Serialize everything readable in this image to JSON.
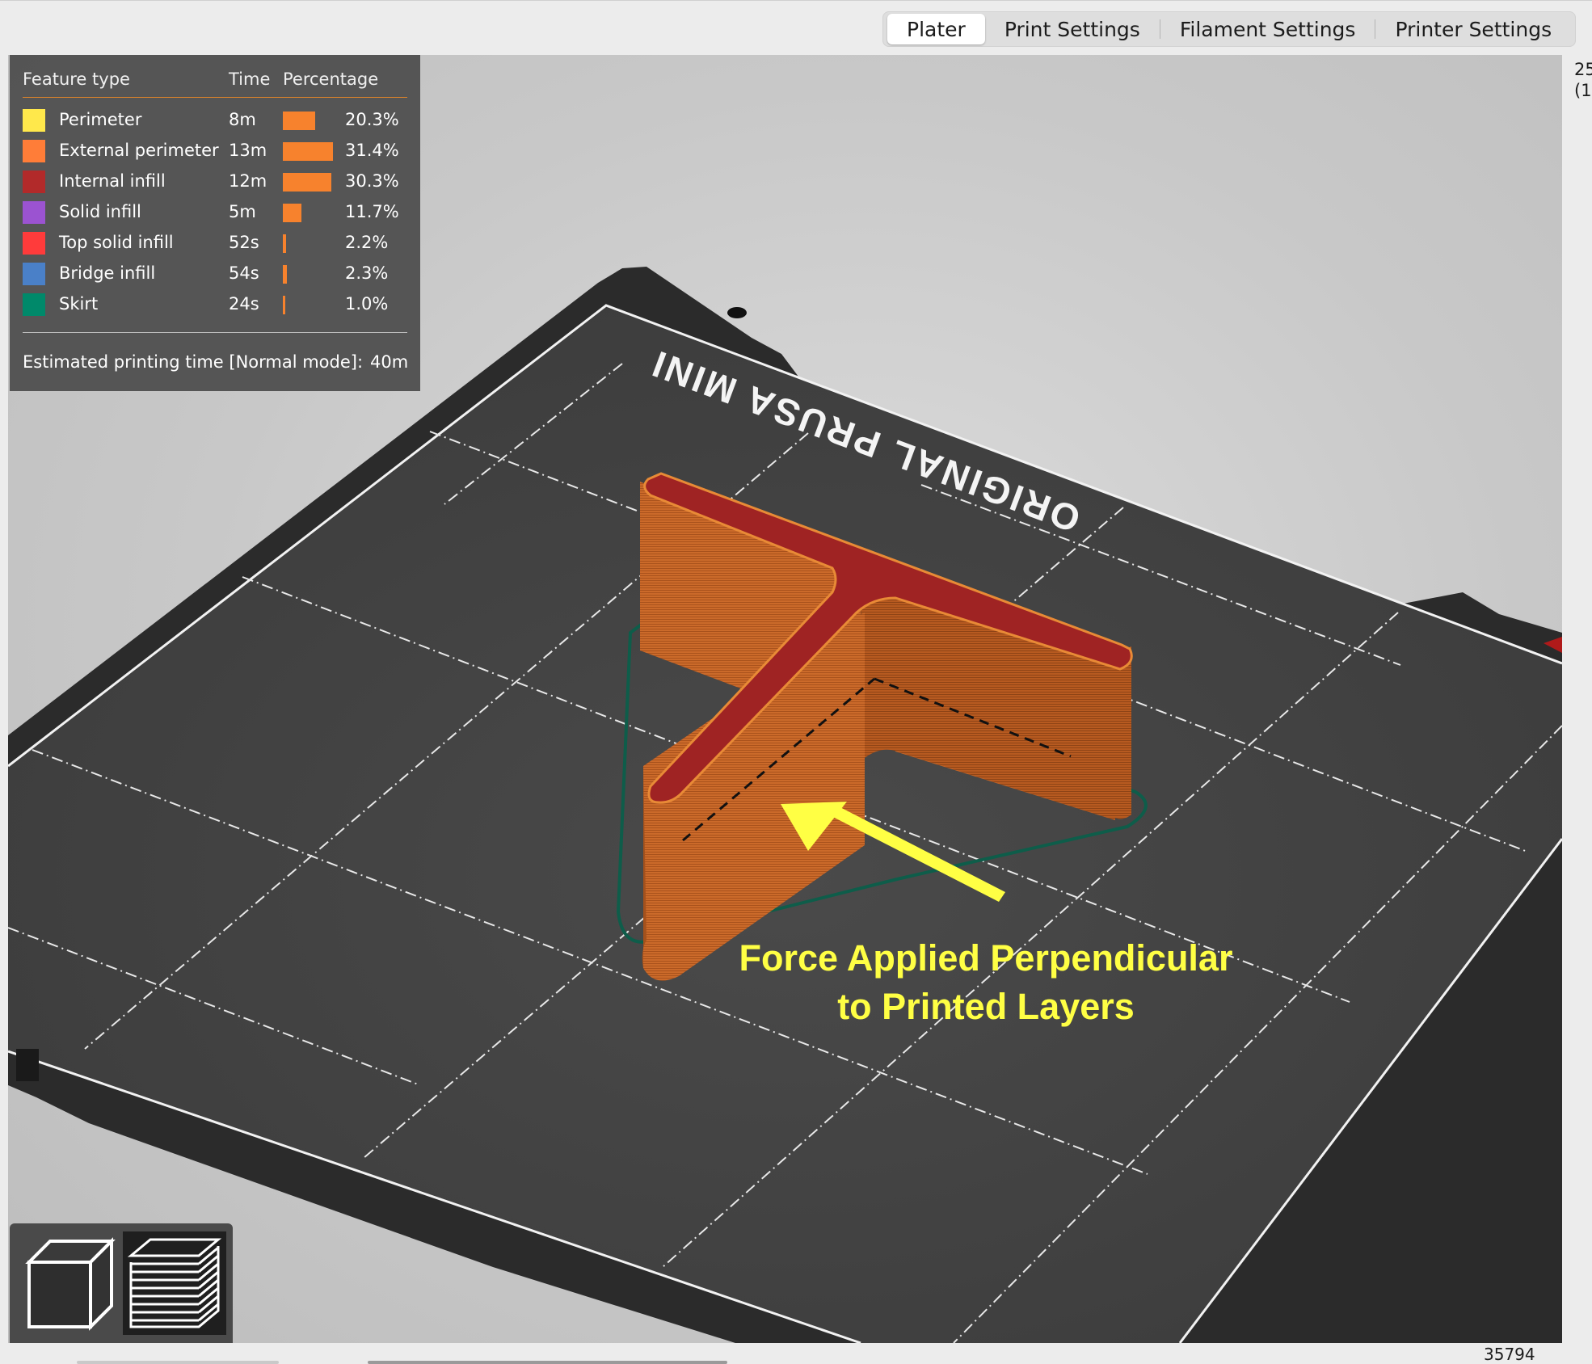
{
  "tabs": [
    {
      "label": "Plater",
      "active": true
    },
    {
      "label": "Print Settings",
      "active": false
    },
    {
      "label": "Filament Settings",
      "active": false
    },
    {
      "label": "Printer Settings",
      "active": false
    }
  ],
  "legend": {
    "headers": {
      "feature": "Feature type",
      "time": "Time",
      "percentage": "Percentage"
    },
    "rows": [
      {
        "name": "Perimeter",
        "time": "8m",
        "percent": "20.3%",
        "fraction": 0.203,
        "color": "#ffe84b"
      },
      {
        "name": "External perimeter",
        "time": "13m",
        "percent": "31.4%",
        "fraction": 0.314,
        "color": "#ff7d38"
      },
      {
        "name": "Internal infill",
        "time": "12m",
        "percent": "30.3%",
        "fraction": 0.303,
        "color": "#b22a2a"
      },
      {
        "name": "Solid infill",
        "time": "5m",
        "percent": "11.7%",
        "fraction": 0.117,
        "color": "#9b53d1"
      },
      {
        "name": "Top solid infill",
        "time": "52s",
        "percent": "2.2%",
        "fraction": 0.022,
        "color": "#ff3b3b"
      },
      {
        "name": "Bridge infill",
        "time": "54s",
        "percent": "2.3%",
        "fraction": 0.023,
        "color": "#4a80c8"
      },
      {
        "name": "Skirt",
        "time": "24s",
        "percent": "1.0%",
        "fraction": 0.01,
        "color": "#00896a"
      }
    ],
    "estimate_label": "Estimated printing time [Normal mode]:",
    "estimate_value": "40m",
    "bar_color": "#f7822d"
  },
  "bed": {
    "label": "ORIGINAL PRUSA MINI"
  },
  "annotation": {
    "line1": "Force Applied Perpendicular",
    "line2": "to Printed Layers",
    "color": "#ffff44"
  },
  "view_buttons": [
    {
      "name": "3d-view",
      "icon": "cube-icon"
    },
    {
      "name": "preview",
      "icon": "layers-icon"
    }
  ],
  "right_strip": {
    "line1": "25",
    "line2": "(1"
  },
  "bottom_readout": "35794"
}
